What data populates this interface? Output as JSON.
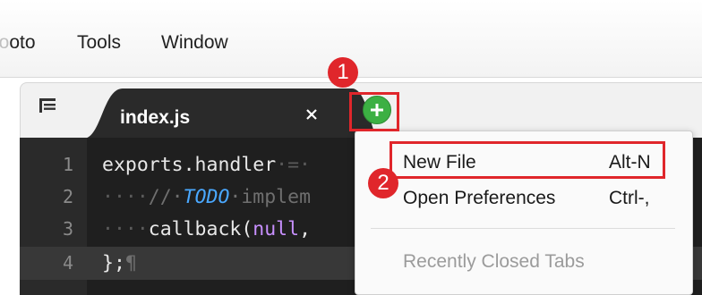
{
  "menubar": {
    "goto_partial_faded": "io",
    "goto_partial": "oto",
    "tools": "Tools",
    "window": "Window"
  },
  "tab": {
    "title": "index.js",
    "close_symbol": "×"
  },
  "editor": {
    "line_numbers": [
      "1",
      "2",
      "3",
      "4"
    ],
    "lines": [
      {
        "code": "exports.handler",
        "rest_ws": "·=·"
      },
      {
        "ws": "····",
        "comment1": "//·",
        "todo": "TODO",
        "comment2": "·implem"
      },
      {
        "ws": "····",
        "code1": "callback(",
        "kw": "null",
        "code2": ","
      },
      {
        "code": "};",
        "pilcrow": "¶"
      }
    ]
  },
  "add_button": {
    "icon": "plus-icon",
    "color": "#3cb043"
  },
  "dropdown": {
    "items": [
      {
        "label": "New File",
        "shortcut": "Alt-N"
      },
      {
        "label": "Open Preferences",
        "shortcut": "Ctrl-,"
      },
      {
        "label": "Recently Closed Tabs",
        "shortcut": ""
      }
    ]
  },
  "annotations": {
    "color": "#e0262b",
    "badge1": "1",
    "badge2": "2"
  }
}
